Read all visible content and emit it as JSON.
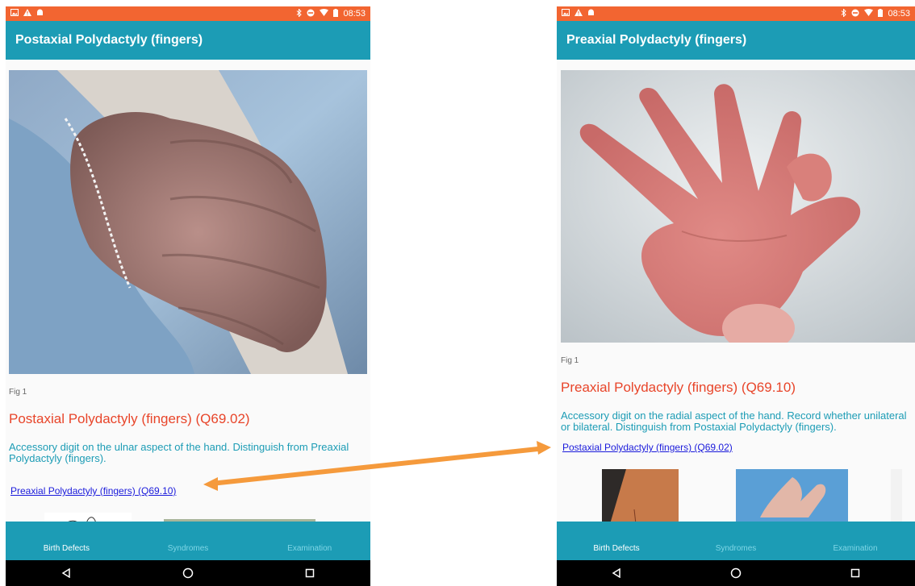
{
  "left_screen": {
    "status_time": "08:53",
    "title": "Postaxial Polydactyly (fingers)",
    "fig_caption": "Fig 1",
    "entry_heading": "Postaxial Polydactyly (fingers) (Q69.02)",
    "entry_description": "Accessory digit on the ulnar aspect of the hand. Distinguish from Preaxial Polydactyly (fingers).",
    "related_link": "Preaxial Polydactyly (fingers) (Q69.10)",
    "tabs": [
      "Birth Defects",
      "Syndromes",
      "Examination"
    ],
    "active_tab": "Birth Defects"
  },
  "right_screen": {
    "status_time": "08:53",
    "title": "Preaxial Polydactyly (fingers)",
    "fig_caption": "Fig 1",
    "entry_heading": "Preaxial Polydactyly (fingers) (Q69.10)",
    "entry_description": "Accessory digit on the radial aspect of the hand. Record whether unilateral or bilateral. Distinguish from Postaxial Polydactyly (fingers).",
    "related_link": "Postaxial Polydactyly (fingers) (Q69.02)",
    "tabs": [
      "Birth Defects",
      "Syndromes",
      "Examination"
    ],
    "active_tab": "Birth Defects"
  },
  "colors": {
    "status_bar": "#f26531",
    "app_bar": "#1c9cb5",
    "heading": "#e8452a",
    "description": "#1c9cb5",
    "link": "#1a1adb",
    "arrow": "#f59a3c"
  },
  "icons": [
    "image-icon",
    "warning-icon",
    "android-icon",
    "bluetooth-icon",
    "do-not-disturb-icon",
    "wifi-icon",
    "battery-icon",
    "back-icon",
    "home-icon",
    "recents-icon"
  ]
}
